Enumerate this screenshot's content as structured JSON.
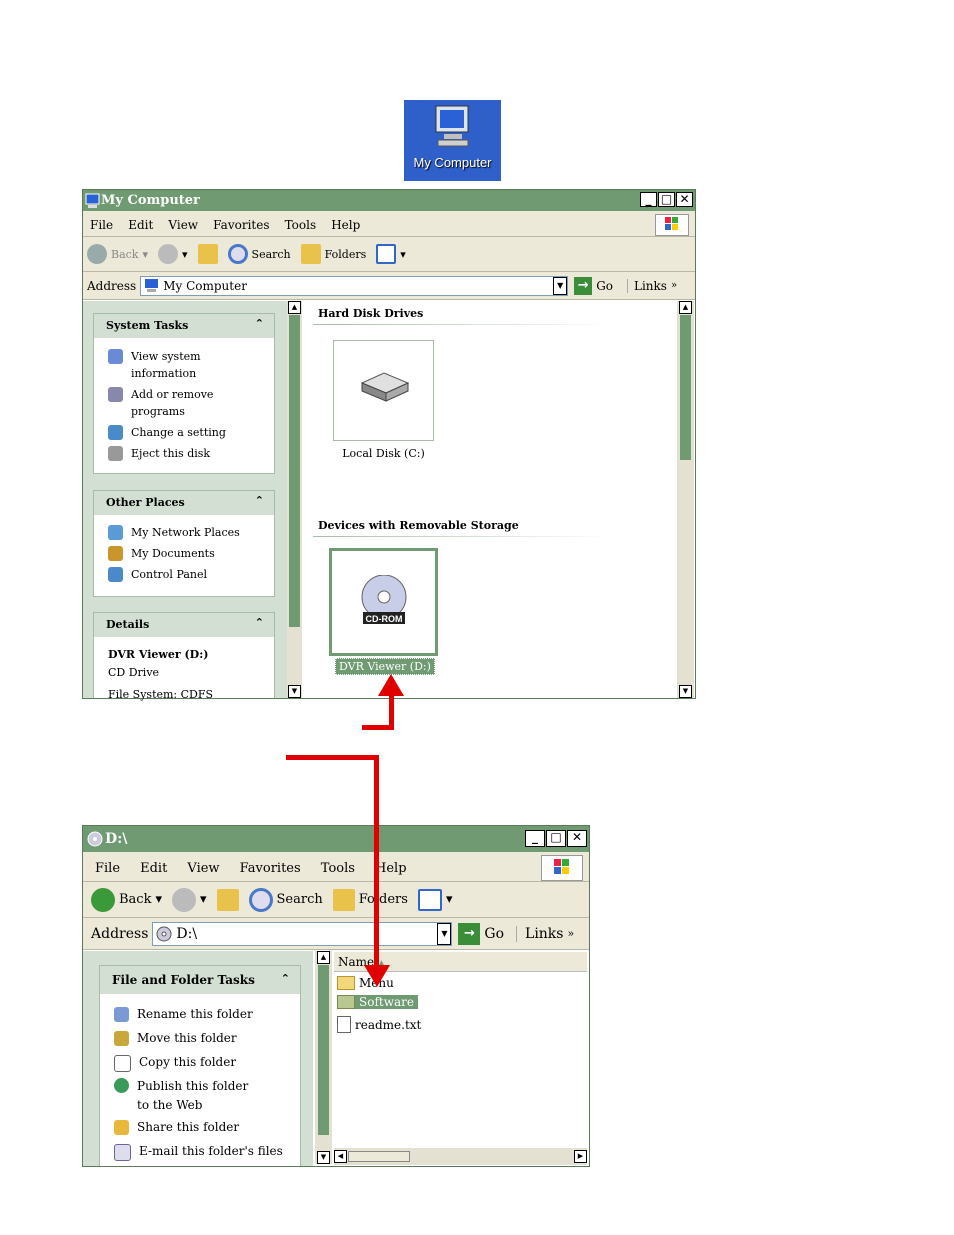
{
  "desktop_icon": {
    "label": "My Computer"
  },
  "win1": {
    "title": "My Computer",
    "menu": [
      "File",
      "Edit",
      "View",
      "Favorites",
      "Tools",
      "Help"
    ],
    "toolbar": {
      "back": "Back",
      "search": "Search",
      "folders": "Folders"
    },
    "address": {
      "label": "Address",
      "value": "My Computer",
      "go": "Go",
      "links": "Links"
    },
    "system_tasks": {
      "header": "System Tasks",
      "items": [
        "View system information",
        "Add or remove programs",
        "Change a setting",
        "Eject this disk"
      ]
    },
    "other_places": {
      "header": "Other Places",
      "items": [
        "My Network Places",
        "My Documents",
        "Control Panel"
      ]
    },
    "details": {
      "header": "Details",
      "name": "DVR Viewer (D:)",
      "type": "CD Drive",
      "fs": "File System: CDFS"
    },
    "hard_disks": {
      "header": "Hard Disk Drives",
      "items": [
        "Local Disk (C:)"
      ]
    },
    "removable": {
      "header": "Devices with Removable Storage",
      "items": [
        "DVR Viewer (D:)"
      ],
      "cd_badge": "CD-ROM"
    }
  },
  "win2": {
    "title": "D:\\",
    "menu": [
      "File",
      "Edit",
      "View",
      "Favorites",
      "Tools",
      "Help"
    ],
    "toolbar": {
      "back": "Back",
      "search": "Search",
      "folders": "Folders"
    },
    "address": {
      "label": "Address",
      "value": "D:\\",
      "go": "Go",
      "links": "Links"
    },
    "tasks": {
      "header": "File and Folder Tasks",
      "items": [
        "Rename this folder",
        "Move this folder",
        "Copy this folder",
        "Publish this folder to the Web",
        "Share this folder",
        "E-mail this folder's files"
      ]
    },
    "files": {
      "column": "Name",
      "items": [
        "Menu",
        "Software",
        "readme.txt"
      ]
    }
  },
  "colors": {
    "accent": "#6f9a72",
    "arrow": "#e00000",
    "desktop": "#2f5fc9"
  }
}
